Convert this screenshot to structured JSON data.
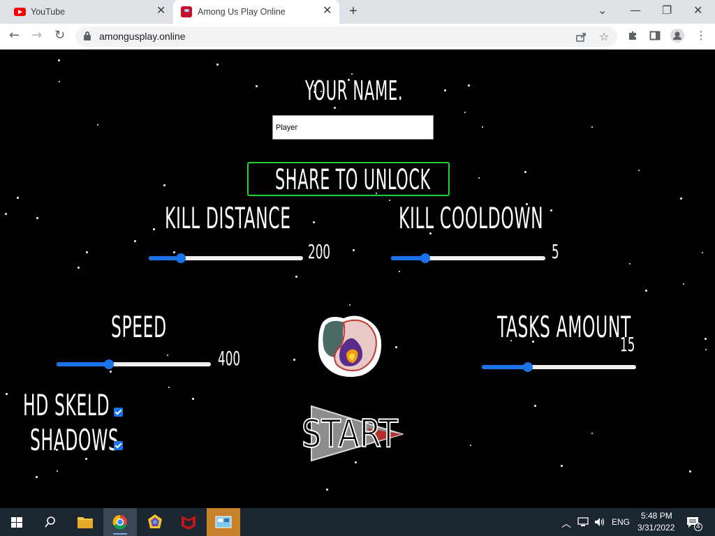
{
  "browser": {
    "tabs": [
      {
        "label": "YouTube",
        "icon": "youtube-icon"
      },
      {
        "label": "Among Us Play Online",
        "icon": "among-us-icon",
        "active": true
      }
    ],
    "new_tab_icon": "plus-icon",
    "window_controls": {
      "tab_search": "⌄",
      "minimize": "—",
      "restore": "❐",
      "close": "✕"
    },
    "url": "amongusplay.online",
    "nav": {
      "back": "←",
      "forward": "→",
      "reload": "↻"
    },
    "toolbar_icons": [
      "share-icon",
      "star-icon",
      "extensions-icon",
      "side-panel-icon",
      "profile-icon",
      "menu-icon"
    ]
  },
  "game": {
    "name_title": "YOUR NAME.",
    "name_value": "Player",
    "share_label": "SHARE TO UNLOCK",
    "kill_distance": {
      "label": "KILL DISTANCE",
      "value": "200",
      "fraction": 0.21
    },
    "kill_cooldown": {
      "label": "KILL COOLDOWN",
      "value": "5",
      "fraction": 0.22
    },
    "speed": {
      "label": "SPEED",
      "value": "400",
      "fraction": 0.34
    },
    "tasks_amount": {
      "label": "TASKS AMOUNT",
      "value": "15",
      "fraction": 0.3
    },
    "hd_skeld": {
      "label": "HD SKELD",
      "checked": true
    },
    "shadows": {
      "label": "SHADOWS",
      "checked": true
    },
    "start_label": "START",
    "accent_color": "#1a73e8",
    "share_border_color": "#1fd32a"
  },
  "taskbar": {
    "language": "ENG",
    "time": "5:48 PM",
    "date": "3/31/2022",
    "notification_count": "4"
  }
}
